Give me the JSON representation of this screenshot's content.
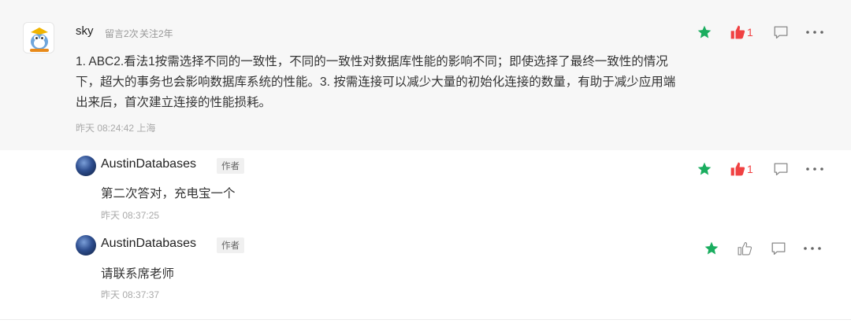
{
  "comment": {
    "username": "sky",
    "message_count": "留言2次",
    "follow_duration": "关注2年",
    "body": "1. ABC2.看法1按需选择不同的一致性，不同的一致性对数据库性能的影响不同；即使选择了最终一致性的情况下，超大的事务也会影响数据库系统的性能。3. 按需连接可以减少大量的初始化连接的数量，有助于减少应用端出来后，首次建立连接的性能损耗。",
    "timestamp": "昨天 08:24:42 上海",
    "like_count": "1"
  },
  "replies": [
    {
      "username": "AustinDatabases",
      "tag": "作者",
      "text": "第二次答对，充电宝一个",
      "timestamp": "昨天 08:37:25",
      "like_count": "1"
    },
    {
      "username": "AustinDatabases",
      "tag": "作者",
      "text": "请联系席老师",
      "timestamp": "昨天 08:37:37",
      "like_count": ""
    }
  ],
  "icons": {
    "star": "star-icon",
    "like": "thumbs-up-icon",
    "comment": "comment-icon",
    "more": "more-dots-icon"
  },
  "colors": {
    "star_green": "#1aad5f",
    "like_red": "#f04142",
    "icon_gray": "#888888",
    "comment_bg": "#f7f7f7"
  }
}
